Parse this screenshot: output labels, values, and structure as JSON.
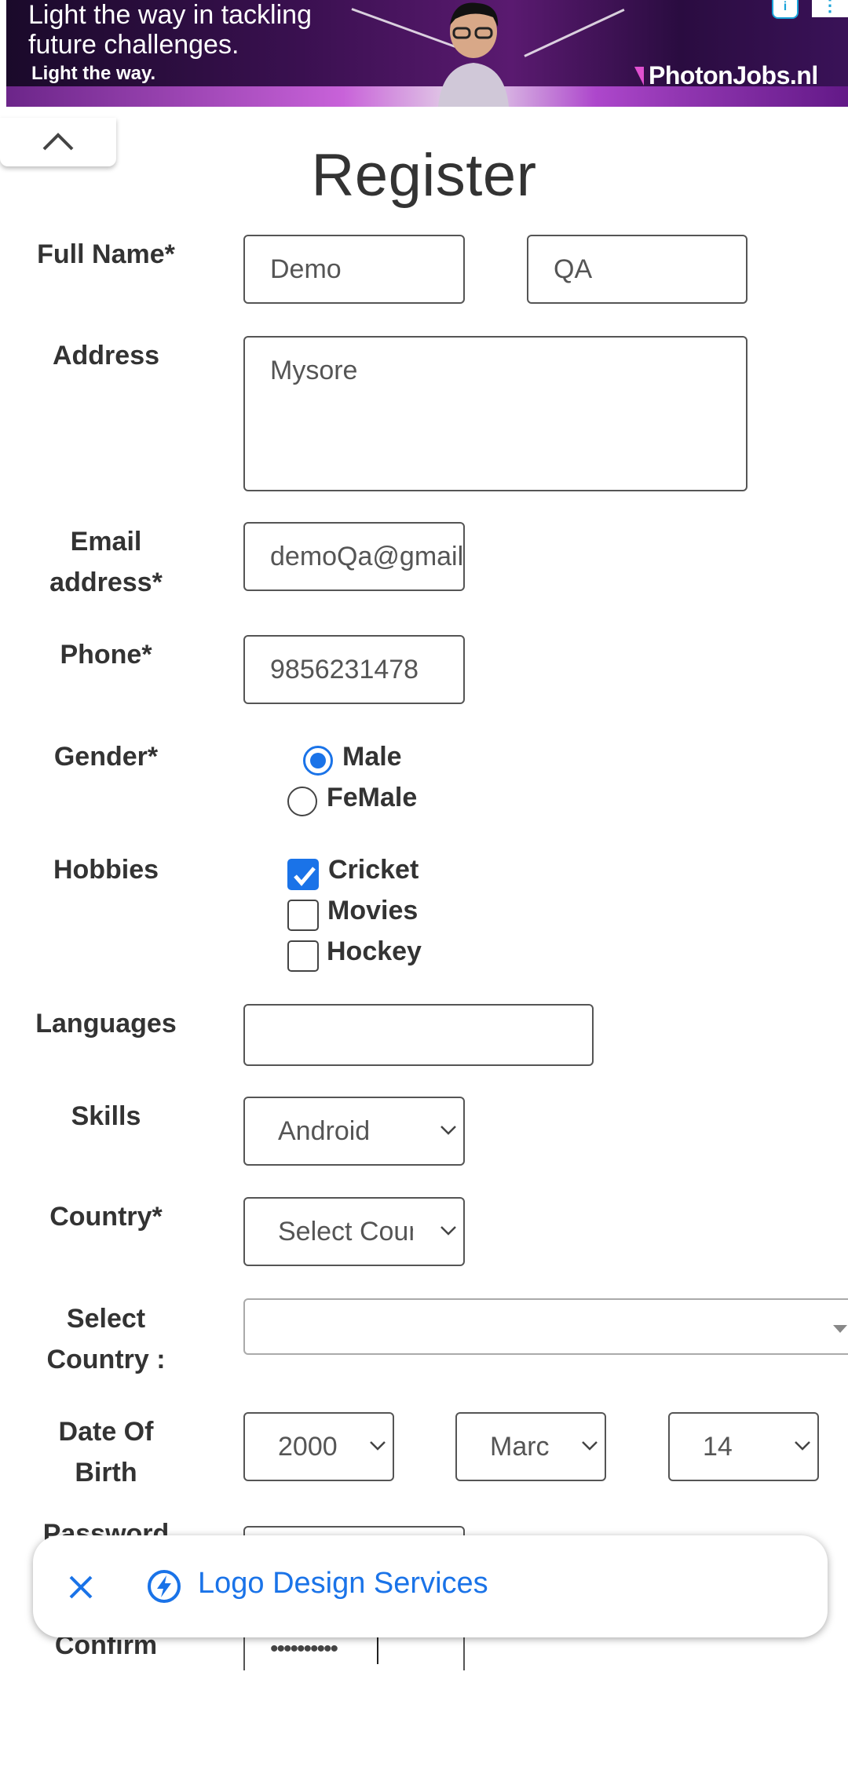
{
  "ad": {
    "headline": "Light the way in tackling\nfuture challenges.",
    "subline": "Light the way.",
    "brand": "PhotonJobs.nl",
    "info_icon": "info-icon",
    "more_icon": "more-vert-icon"
  },
  "collapse_icon": "chevron-up-icon",
  "page": {
    "title": "Register"
  },
  "form": {
    "full_name": {
      "label": "Full Name*",
      "first": "Demo",
      "last": "QA"
    },
    "address": {
      "label": "Address",
      "value": "Mysore"
    },
    "email": {
      "label": "Email address*",
      "value": "demoQa@gmail.com"
    },
    "phone": {
      "label": "Phone*",
      "value": "9856231478"
    },
    "gender": {
      "label": "Gender*",
      "options": [
        "Male",
        "FeMale"
      ],
      "selected": "Male"
    },
    "hobbies": {
      "label": "Hobbies",
      "options": [
        "Cricket",
        "Movies",
        "Hockey"
      ],
      "checked": [
        "Cricket"
      ]
    },
    "languages": {
      "label": "Languages",
      "value": ""
    },
    "skills": {
      "label": "Skills",
      "value": "Android"
    },
    "country": {
      "label": "Country*",
      "value": "Select Country"
    },
    "select_country": {
      "label": "Select Country :",
      "value": ""
    },
    "dob": {
      "label": "Date Of Birth",
      "year": "2000",
      "month": "March",
      "day": "14"
    },
    "password": {
      "label": "Password"
    },
    "confirm": {
      "label": "Confirm",
      "value": "••••••••••"
    }
  },
  "promo": {
    "text": "Logo Design Services",
    "close_icon": "close-icon",
    "bolt_icon": "bolt-icon"
  },
  "colors": {
    "accent": "#1a73e8",
    "text": "#333333",
    "border": "#555555"
  }
}
